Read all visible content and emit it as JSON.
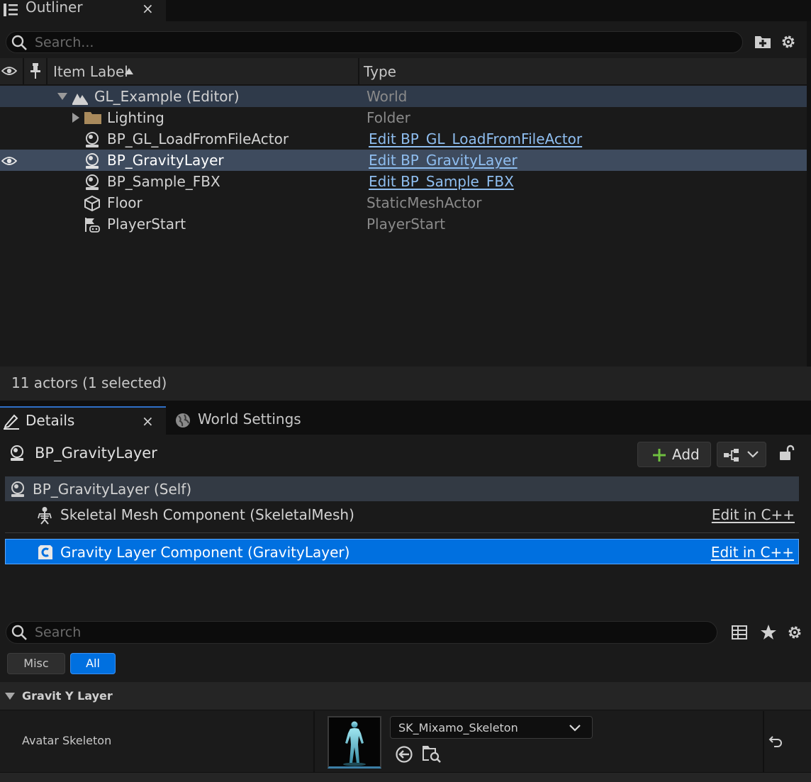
{
  "outliner": {
    "tab_title": "Outliner",
    "close_glyph": "×",
    "search_placeholder": "Search...",
    "columns": {
      "label": "Item Label",
      "type": "Type"
    },
    "rows": [
      {
        "label": "GL_Example (Editor)",
        "type": "World",
        "icon": "world-icon"
      },
      {
        "label": "Lighting",
        "type": "Folder",
        "icon": "folder-icon"
      },
      {
        "label": "BP_GL_LoadFromFileActor",
        "type": "Edit BP_GL_LoadFromFileActor",
        "icon": "blueprint-actor-icon"
      },
      {
        "label": "BP_GravityLayer",
        "type": "Edit BP_GravityLayer",
        "icon": "blueprint-actor-icon",
        "selected": true
      },
      {
        "label": "BP_Sample_FBX",
        "type": "Edit BP_Sample_FBX",
        "icon": "blueprint-actor-icon"
      },
      {
        "label": "Floor",
        "type": "StaticMeshActor",
        "icon": "static-mesh-icon"
      },
      {
        "label": "PlayerStart",
        "type": "PlayerStart",
        "icon": "player-start-icon"
      }
    ],
    "footer_status": "11 actors (1 selected)"
  },
  "details": {
    "tab_title": "Details",
    "close_glyph": "×",
    "world_settings_tab": "World Settings",
    "actor_name": "BP_GravityLayer",
    "add_button": "Add",
    "components": [
      {
        "label": "BP_GravityLayer (Self)",
        "edit": ""
      },
      {
        "label": "Skeletal Mesh Component (SkeletalMesh)",
        "edit": "Edit in C++"
      },
      {
        "label": "Gravity Layer Component (GravityLayer)",
        "edit": "Edit in C++",
        "selected": true
      }
    ],
    "search_placeholder": "Search",
    "filters": [
      {
        "label": "Misc",
        "active": false
      },
      {
        "label": "All",
        "active": true
      }
    ],
    "category": "Gravit Y Layer",
    "property": {
      "name": "Avatar Skeleton",
      "value": "SK_Mixamo_Skeleton"
    }
  },
  "colors": {
    "selection_row": "#3e4b5e",
    "selection_blue": "#0070e0",
    "link": "#8fbef0",
    "add_plus": "#6fbf3f"
  }
}
